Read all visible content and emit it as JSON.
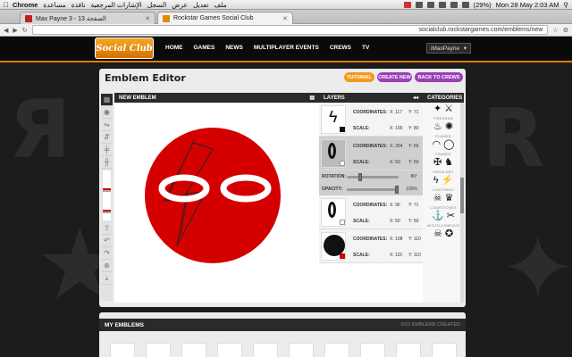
{
  "menubar": {
    "app_name": "Chrome",
    "menus": [
      "ملف",
      "تعديل",
      "عرض",
      "السجل",
      "الإشارات المرجعية",
      "نافذة",
      "مساعدة"
    ],
    "battery": "(29%)",
    "datetime": "Mon 28 May  2:03 AM"
  },
  "tabs": [
    {
      "title": "Max Payne 3 - الصفحة 13",
      "color": "#b22"
    },
    {
      "title": "Rockstar Games Social Club",
      "color": "#e08a00"
    }
  ],
  "url": "socialclub.rockstargames.com/emblems/new",
  "site": {
    "logo_top": "ROCKSTAR GAMES",
    "logo": "Social Club",
    "nav": [
      "HOME",
      "GAMES",
      "NEWS",
      "MULTIPLAYER EVENTS",
      "CREWS",
      "TV"
    ],
    "user": "iMaxPayne"
  },
  "editor": {
    "title": "Emblem Editor",
    "buttons": {
      "tutorial": "TUTORIAL",
      "create_new": "CREATE NEW",
      "back": "BACK TO CREWS"
    },
    "canvas_header": "NEW EMBLEM",
    "layers_header": "LAYERS",
    "categories_header": "CATEGORIES",
    "layers": [
      {
        "coords_label": "COORDINATES:",
        "x": "X: 117",
        "y": "Y: 71",
        "scale_label": "SCALE:",
        "sx": "X: 100",
        "sy": "Y: 80",
        "swatch": "#111111"
      },
      {
        "coords_label": "COORDINATES:",
        "x": "X: 264",
        "y": "Y: 66",
        "scale_label": "SCALE:",
        "sx": "X: 50",
        "sy": "Y: 50",
        "swatch": "#ffffff",
        "selected": true
      },
      {
        "coords_label": "COORDINATES:",
        "x": "X: 96",
        "y": "Y: 71",
        "scale_label": "SCALE:",
        "sx": "X: 50",
        "sy": "Y: 50",
        "swatch": "#ffffff"
      },
      {
        "coords_label": "COORDINATES:",
        "x": "X: 108",
        "y": "Y: 110",
        "scale_label": "SCALE:",
        "sx": "X: 115",
        "sy": "Y: 110",
        "swatch": "#cc0000"
      }
    ],
    "rotation_label": "ROTATION:",
    "rotation_value": "86°",
    "rotation_fraction": 0.24,
    "opacity_label": "OPACITY:",
    "opacity_value": "100%",
    "opacity_fraction": 1.0,
    "categories": [
      {
        "label": "FIREARMS",
        "icons": [
          "✦",
          "⚔"
        ]
      },
      {
        "label": "FLAMES",
        "icons": [
          "♨",
          "✺"
        ]
      },
      {
        "label": "FRAMES",
        "icons": [
          "◠",
          "◯"
        ]
      },
      {
        "label": "HERALDRY",
        "icons": [
          "✠",
          "♞"
        ]
      },
      {
        "label": "LIGHTNING",
        "icons": [
          "ϟ",
          "⚡"
        ]
      },
      {
        "label": "LODESTONES",
        "icons": [
          "☠",
          "♛"
        ]
      },
      {
        "label": "MISCELLANEOUS",
        "icons": [
          "⚓",
          "✂"
        ]
      },
      {
        "label": "",
        "icons": [
          "☠",
          "✪"
        ]
      }
    ],
    "emblem_colors": {
      "circle": "#d40000",
      "ring": "#ffffff"
    }
  },
  "my_emblems": {
    "title": "MY EMBLEMS",
    "count": "0/10 EMBLEMS CREATED"
  }
}
